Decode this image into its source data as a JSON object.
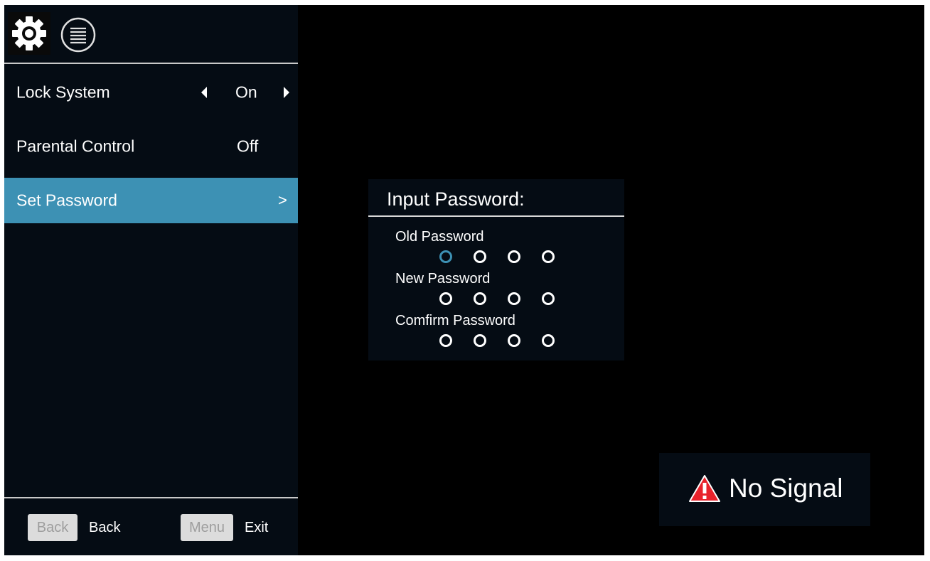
{
  "menu": {
    "header": {
      "icons": [
        "gear-icon",
        "list-icon"
      ]
    },
    "items": [
      {
        "label": "Lock System",
        "value": "On",
        "has_arrows": true
      },
      {
        "label": "Parental Control",
        "value": "Off"
      },
      {
        "label": "Set Password",
        "value": ">",
        "selected": true
      }
    ],
    "footer": {
      "back_key": "Back",
      "back_desc": "Back",
      "menu_key": "Menu",
      "exit_desc": "Exit"
    }
  },
  "password_dialog": {
    "title": "Input Password:",
    "fields": [
      {
        "label": "Old Password",
        "digits": 4,
        "active_digit": 0
      },
      {
        "label": "New Password",
        "digits": 4
      },
      {
        "label": "Comfirm Password",
        "digits": 4
      }
    ]
  },
  "status": {
    "no_signal": "No Signal",
    "icon": "warning-icon"
  },
  "colors": {
    "accent": "#3d91b4",
    "panel_bg": "#050c14",
    "screen_bg": "#000000",
    "warning_red": "#e8222b"
  }
}
